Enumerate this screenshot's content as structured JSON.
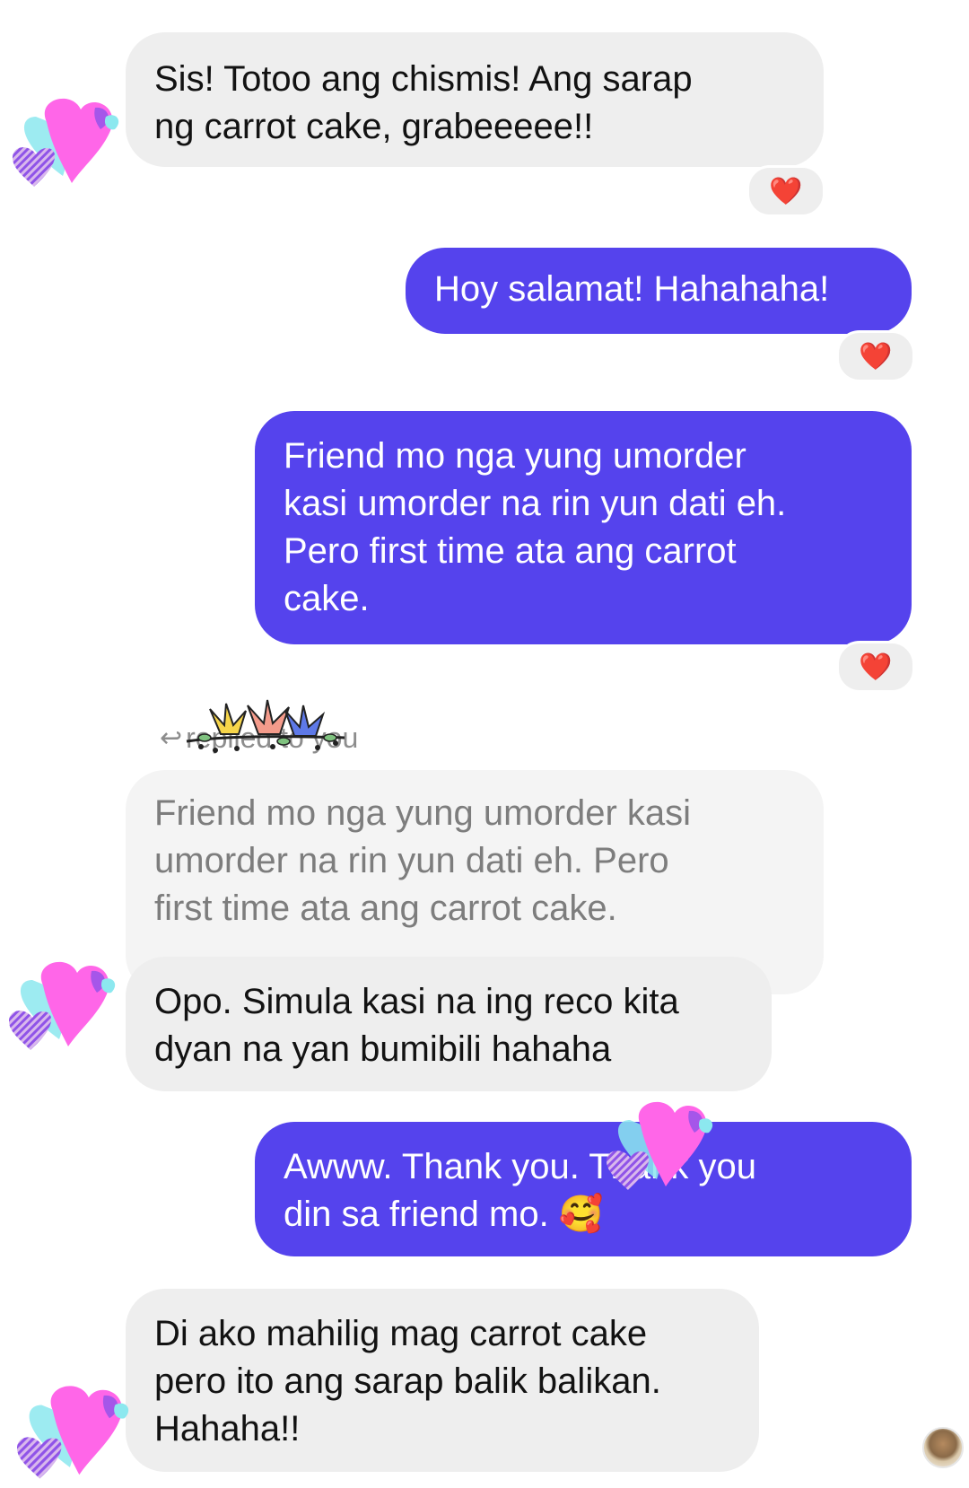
{
  "messages": [
    {
      "sender": "them",
      "text": "Sis! Totoo ang chismis! Ang sarap\nng carrot cake, grabeeeee!!",
      "reaction": "❤️"
    },
    {
      "sender": "me",
      "text": "Hoy salamat! Hahahaha!",
      "reaction": "❤️"
    },
    {
      "sender": "me",
      "text": "Friend mo nga yung umorder\nkasi umorder na rin yun dati eh.\nPero first time ata ang carrot\ncake.",
      "reaction": "❤️"
    },
    {
      "sender": "them",
      "reply_label": "replied to you",
      "quoted_text": "Friend mo nga yung umorder kasi\numorder na rin yun dati eh. Pero\nfirst time ata ang carrot cake.",
      "text": "Opo. Simula kasi na ing reco kita\ndyan na yan bumibili hahaha"
    },
    {
      "sender": "me",
      "text": "Awww. Thank you. Thank you\ndin sa friend mo. 🥰"
    },
    {
      "sender": "them",
      "text": "Di ako mahilig mag carrot cake\npero ito ang sarap balik balikan.\nHahaha!!"
    }
  ],
  "icons": {
    "reply": "reply-arrow-icon",
    "sticker": "heart-sticker-icon",
    "flower": "flower-sticker-icon"
  },
  "colors": {
    "outgoing_bubble": "#5543ed",
    "incoming_bubble": "#eeeeee",
    "quoted_bubble": "#f4f4f4",
    "reaction_heart": "#e0101b",
    "sticker_pink": "#ff66e8",
    "sticker_violet": "#8f53e8",
    "sticker_cyan": "#8ce8ef"
  }
}
